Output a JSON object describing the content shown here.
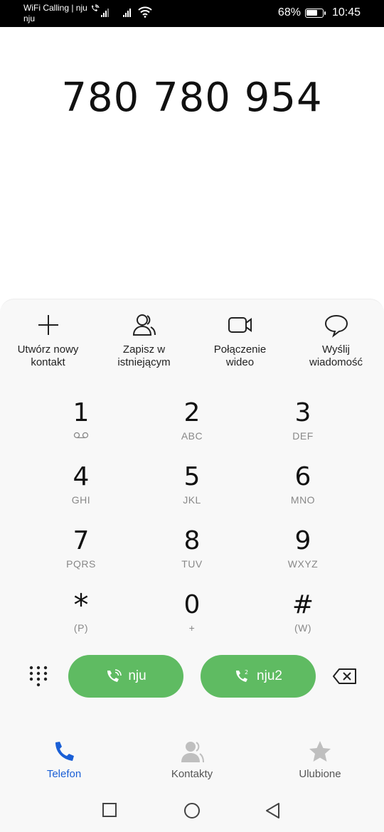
{
  "status_bar": {
    "carrier_line1": "WiFi Calling | nju",
    "carrier_line2": "nju",
    "battery": "68%",
    "time": "10:45",
    "battery_level": 0.68
  },
  "dialer": {
    "number": "780 780 954"
  },
  "actions": [
    {
      "label_line1": "Utwórz nowy",
      "label_line2": "kontakt",
      "icon": "plus-icon"
    },
    {
      "label_line1": "Zapisz w",
      "label_line2": "istniejącym",
      "icon": "person-add-icon"
    },
    {
      "label_line1": "Połączenie",
      "label_line2": "wideo",
      "icon": "video-icon"
    },
    {
      "label_line1": "Wyślij",
      "label_line2": "wiadomość",
      "icon": "message-icon"
    }
  ],
  "keypad": [
    {
      "digit": "1",
      "letters": ""
    },
    {
      "digit": "2",
      "letters": "ABC"
    },
    {
      "digit": "3",
      "letters": "DEF"
    },
    {
      "digit": "4",
      "letters": "GHI"
    },
    {
      "digit": "5",
      "letters": "JKL"
    },
    {
      "digit": "6",
      "letters": "MNO"
    },
    {
      "digit": "7",
      "letters": "PQRS"
    },
    {
      "digit": "8",
      "letters": "TUV"
    },
    {
      "digit": "9",
      "letters": "WXYZ"
    },
    {
      "digit": "*",
      "letters": "(P)"
    },
    {
      "digit": "0",
      "letters": "+"
    },
    {
      "digit": "#",
      "letters": "(W)"
    }
  ],
  "call_buttons": {
    "sim1_label": "nju",
    "sim2_label": "nju2",
    "color": "#5fbb62"
  },
  "bottom_nav": {
    "phone": "Telefon",
    "contacts": "Kontakty",
    "favorites": "Ulubione",
    "active_color": "#1a5fd6"
  }
}
